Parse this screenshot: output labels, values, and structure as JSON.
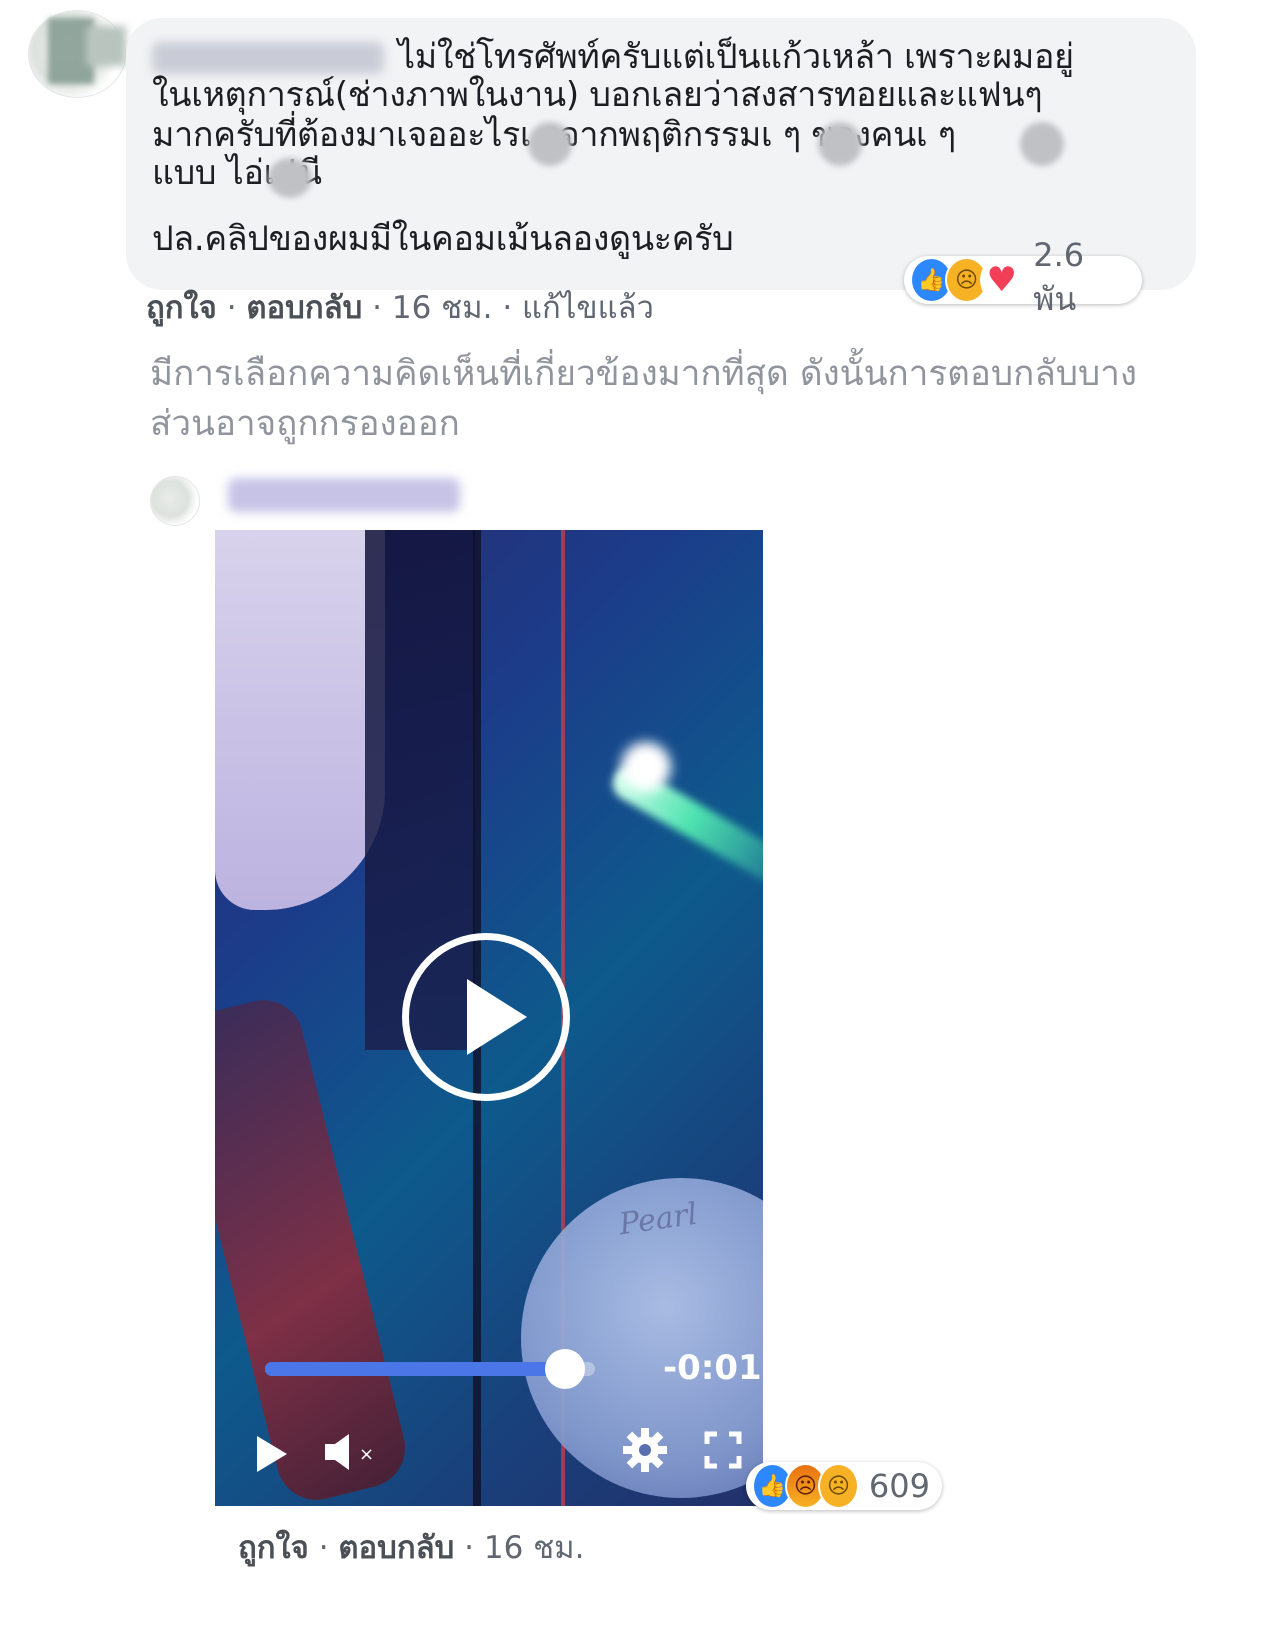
{
  "comment": {
    "author_blurred": true,
    "lines": [
      "ไม่ใช่โทรศัพท์ครับแต่เป็นแก้วเหล้า เพราะผมอยู่",
      "ในเหตุการณ์(ช่างภาพในงาน) บอกเลยว่าสงสารทอยและแฟนๆ",
      "มากครับที่ต้องมาเจออะไรเ   ๆจากพฤติกรรมเ   ๆ ของคนเ   ๆ",
      "แบบ ไอ่เ   !นี"
    ],
    "ps": "ปล.คลิปของผมมีในคอมเม้นลองดูนะครับ",
    "actions": {
      "like": "ถูกใจ",
      "reply": "ตอบกลับ",
      "time": "16 ชม.",
      "edited": "แก้ไขแล้ว",
      "sep": " · "
    },
    "reactions": {
      "icons": [
        "like-icon",
        "sad-icon",
        "love-icon"
      ],
      "count": "2.6 พัน"
    }
  },
  "notice": {
    "line1": "มีการเลือกความคิดเห็นที่เกี่ยวข้องมากที่สุด ดังนั้นการตอบกลับบาง",
    "line2": "ส่วนอาจถูกกรองออก"
  },
  "reply": {
    "author_blurred": true,
    "video": {
      "time_remaining": "-0:01",
      "progress": 0.91,
      "muted": true,
      "watermark": "Pearl"
    },
    "reactions": {
      "icons": [
        "like-icon",
        "angry-icon",
        "sad-icon"
      ],
      "count": "609"
    },
    "actions": {
      "like": "ถูกใจ",
      "reply": "ตอบกลับ",
      "time": "16 ชม.",
      "sep": " · "
    }
  },
  "colors": {
    "bubble": "#f2f3f5",
    "link": "#4b4f56",
    "muted": "#90949c",
    "like_blue": "#2d88ff",
    "progress": "#4a76e8"
  }
}
